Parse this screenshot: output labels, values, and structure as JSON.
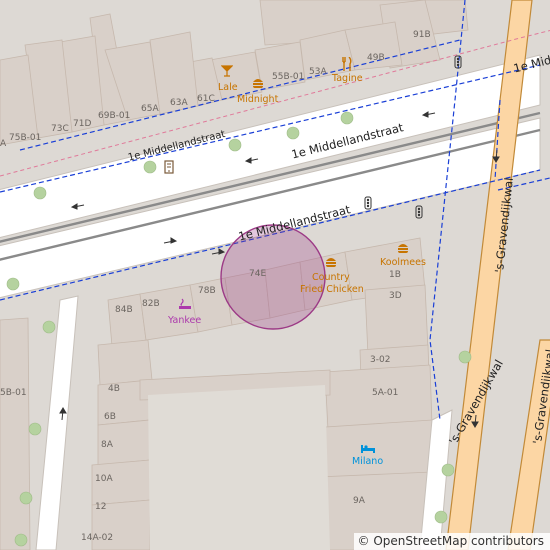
{
  "map": {
    "attribution": "© OpenStreetMap contributors",
    "colors": {
      "land": "#ddd9d4",
      "building": "#d9d0c9",
      "building_stroke": "#c6b8ad",
      "road": "#ffffff",
      "primary": "#fcd6a4",
      "primary_casing": "#c28a38",
      "rail": "#888888",
      "cycle": "#1a3fd6",
      "highlight": "#9c3a86",
      "poi_food": "#c77400",
      "poi_shop": "#ac39ac",
      "poi_hotel": "#0092da",
      "tree": "#b5d29f"
    },
    "streets": {
      "upper": "1e Middellandstraat",
      "mid": "1e Middellandstraat",
      "lower": "1e Middellandstraat",
      "kwal1": "'s-Gravendijkwal",
      "kwal2": "'s-Gravendijkwal",
      "kwal3": "'s-Gravendijkwal"
    },
    "pois": {
      "lale": "Lale",
      "midnight": "Midnight",
      "tagine": "Tagine",
      "country": "Country",
      "fried_chicken": "Fried Chicken",
      "koolmees": "Koolmees",
      "yankee": "Yankee",
      "milano": "Milano"
    },
    "house_numbers": {
      "n91b": "91B",
      "n55b01": "55B-01",
      "n53a": "53A",
      "n49b": "49B",
      "n69b01": "69B-01",
      "n65a": "65A",
      "n63a": "63A",
      "n61c": "61C",
      "n75b01": "75B-01",
      "n73c": "73C",
      "n71d": "71D",
      "na": "A",
      "n74e": "74E",
      "n84b": "84B",
      "n82b": "82B",
      "n78b": "78B",
      "n1b": "1B",
      "n3d": "3D",
      "n302": "3-02",
      "n5a01": "5A-01",
      "n4b": "4B",
      "n6b": "6B",
      "n8a": "8A",
      "n10a": "10A",
      "n12": "12",
      "n14a02": "14A-02",
      "n9a": "9A",
      "n5b01": "5B-01"
    }
  }
}
